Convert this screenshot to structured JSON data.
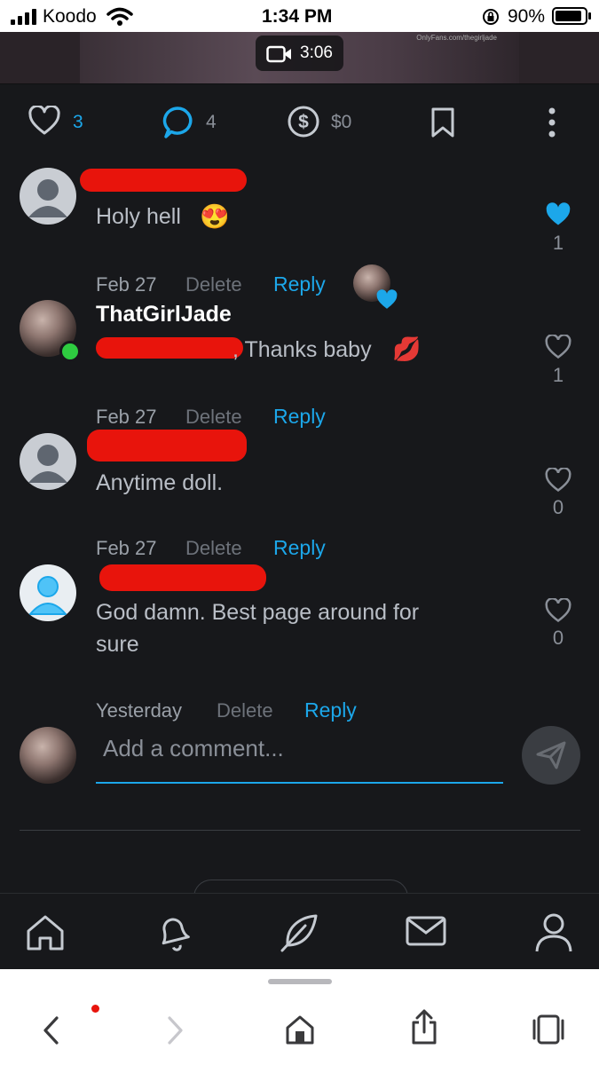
{
  "status_bar": {
    "carrier": "Koodo",
    "time": "1:34 PM",
    "battery": "90%",
    "battery_level": 0.9
  },
  "media": {
    "duration": "3:06",
    "watermark": "OnlyFans.com/thegirljade"
  },
  "actions": {
    "likes": "3",
    "comments": "4",
    "tips": "$0"
  },
  "comments": [
    {
      "username": "",
      "text": "Holy hell",
      "emoji": "😍",
      "date": "Feb 27",
      "delete_label": "Delete",
      "reply_label": "Reply",
      "like_count": "1",
      "liked": true
    },
    {
      "username": "ThatGirlJade",
      "text": ", Thanks baby",
      "emoji": "💋",
      "date": "Feb 27",
      "delete_label": "Delete",
      "reply_label": "Reply",
      "like_count": "1",
      "liked": false
    },
    {
      "username": "",
      "text": "Anytime doll.",
      "date": "Feb 27",
      "delete_label": "Delete",
      "reply_label": "Reply",
      "like_count": "0",
      "liked": false
    },
    {
      "username": "",
      "text_line1": "God damn. Best page around for",
      "text_line2": "sure",
      "date": "Yesterday",
      "delete_label": "Delete",
      "reply_label": "Reply",
      "like_count": "0",
      "liked": false
    }
  ],
  "comment_input": {
    "placeholder": "Add a comment..."
  },
  "colors": {
    "accent": "#1ca7ea",
    "background": "#17181b",
    "online": "#2ecc40",
    "redaction": "#e8140c"
  },
  "icons": {
    "bottom_nav": [
      "home-icon",
      "bell-icon",
      "feather-icon",
      "mail-icon",
      "user-icon"
    ],
    "safari": [
      "back-icon",
      "forward-icon",
      "home-icon",
      "share-icon",
      "tabs-icon"
    ]
  }
}
